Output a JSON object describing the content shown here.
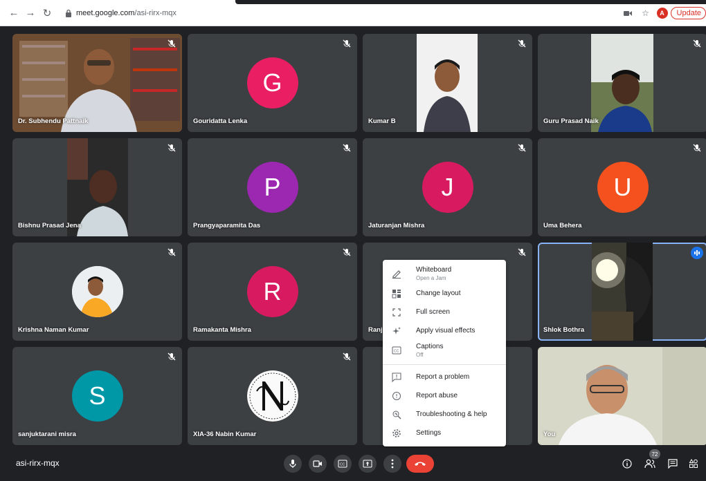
{
  "browser": {
    "url_host": "meet.google.com",
    "url_path": "/asi-rirx-mqx",
    "profile_initial": "A",
    "update_label": "Update"
  },
  "tiles": [
    {
      "name": "Dr. Subhendu Pattnaik",
      "type": "video"
    },
    {
      "name": "Gouridatta Lenka",
      "type": "avatar",
      "letter": "G",
      "color": "#e91e63"
    },
    {
      "name": "Kumar B",
      "type": "video"
    },
    {
      "name": "Guru Prasad Naik",
      "type": "video"
    },
    {
      "name": "Bishnu Prasad Jena",
      "type": "video"
    },
    {
      "name": "Prangyaparamita Das",
      "type": "avatar",
      "letter": "P",
      "color": "#9c27b0"
    },
    {
      "name": "Jaturanjan Mishra",
      "type": "avatar",
      "letter": "J",
      "color": "#d81b60"
    },
    {
      "name": "Uma Behera",
      "type": "avatar",
      "letter": "U",
      "color": "#f4511e"
    },
    {
      "name": "Krishna Naman Kumar",
      "type": "photo"
    },
    {
      "name": "Ramakanta Mishra",
      "type": "avatar",
      "letter": "R",
      "color": "#d81b60"
    },
    {
      "name": "Ranj",
      "type": "blank"
    },
    {
      "name": "Shlok Bothra",
      "type": "video",
      "speaking": true
    },
    {
      "name": "sanjuktarani misra",
      "type": "avatar",
      "letter": "S",
      "color": "#0097a7"
    },
    {
      "name": "XIA-36 Nabin Kumar",
      "type": "logo"
    },
    {
      "name": "",
      "type": "blank"
    },
    {
      "name": "You",
      "type": "video"
    }
  ],
  "menu": {
    "items": [
      {
        "label": "Whiteboard",
        "sub": "Open a Jam",
        "icon": "pen-icon"
      },
      {
        "label": "Change layout",
        "icon": "layout-icon"
      },
      {
        "label": "Full screen",
        "icon": "fullscreen-icon"
      },
      {
        "label": "Apply visual effects",
        "icon": "sparkle-icon"
      },
      {
        "label": "Captions",
        "sub": "Off",
        "icon": "captions-icon"
      },
      {
        "label": "Report a problem",
        "icon": "report-icon"
      },
      {
        "label": "Report abuse",
        "icon": "alert-icon"
      },
      {
        "label": "Troubleshooting & help",
        "icon": "troubleshoot-icon"
      },
      {
        "label": "Settings",
        "icon": "gear-icon"
      }
    ]
  },
  "bottom": {
    "meeting_code": "asi-rirx-mqx",
    "participant_count": "72"
  },
  "colors": {
    "background": "#202124",
    "tile": "#3c4043",
    "hangup": "#ea4335",
    "accent": "#1a73e8"
  }
}
